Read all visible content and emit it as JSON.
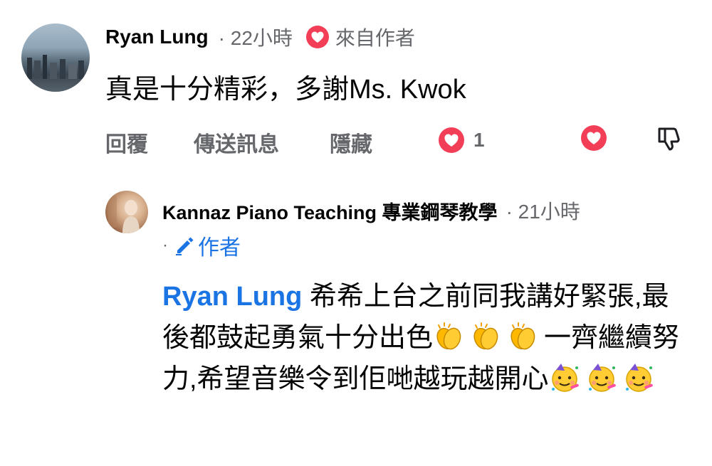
{
  "comment": {
    "author": "Ryan Lung",
    "time": "· 22小時",
    "from_author_label": "來自作者",
    "text": "真是十分精彩，多謝Ms. Kwok",
    "actions": {
      "reply": "回覆",
      "send_message": "傳送訊息",
      "hide": "隱藏"
    },
    "reaction_count": "1"
  },
  "reply": {
    "author": "Kannaz Piano Teaching 專業鋼琴教學",
    "time": "· 21小時",
    "author_badge_prefix": "·",
    "author_badge": "作者",
    "mention": "Ryan Lung",
    "text_part1": " 希希上台之前同我講好緊張,最後都鼓起勇氣十分出色",
    "text_part2": "一齊繼續努力,希望音樂令到佢哋越玩越開心",
    "emoji_clap": "clapping-hands-emoji",
    "emoji_party": "partying-face-emoji"
  },
  "colors": {
    "accent": "#1b74e4",
    "heart": "#f33e58",
    "meta": "#65676b"
  }
}
